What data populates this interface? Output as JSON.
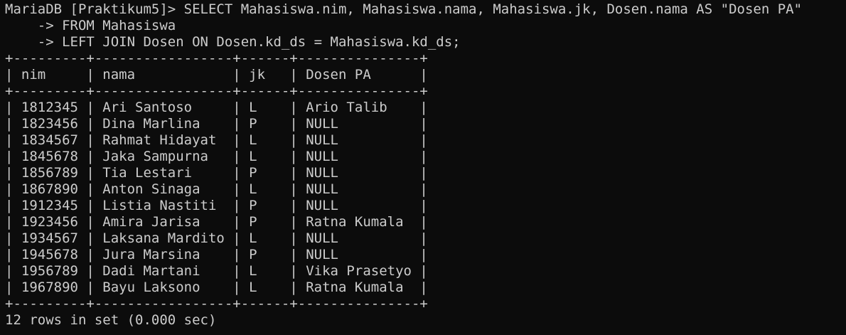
{
  "terminal": {
    "prompt": "MariaDB [Praktikum5]>",
    "query_line_1": "MariaDB [Praktikum5]> SELECT Mahasiswa.nim, Mahasiswa.nama, Mahasiswa.jk, Dosen.nama AS \"Dosen PA\"",
    "query_line_2": "    -> FROM Mahasiswa",
    "query_line_3": "    -> LEFT JOIN Dosen ON Dosen.kd_ds = Mahasiswa.kd_ds;",
    "border_top": "+---------+-----------------+------+---------------+",
    "header_row": "| nim     | nama            | jk   | Dosen PA      |",
    "border_mid": "+---------+-----------------+------+---------------+",
    "rows": [
      "| 1812345 | Ari Santoso     | L    | Ario Talib    |",
      "| 1823456 | Dina Marlina    | P    | NULL          |",
      "| 1834567 | Rahmat Hidayat  | L    | NULL          |",
      "| 1845678 | Jaka Sampurna   | L    | NULL          |",
      "| 1856789 | Tia Lestari     | P    | NULL          |",
      "| 1867890 | Anton Sinaga    | L    | NULL          |",
      "| 1912345 | Listia Nastiti  | P    | NULL          |",
      "| 1923456 | Amira Jarisa    | P    | Ratna Kumala  |",
      "| 1934567 | Laksana Mardito | L    | NULL          |",
      "| 1945678 | Jura Marsina    | P    | NULL          |",
      "| 1956789 | Dadi Martani    | L    | Vika Prasetyo |",
      "| 1967890 | Bayu Laksono    | L    | Ratna Kumala  |"
    ],
    "border_bottom": "+---------+-----------------+------+---------------+",
    "status": "12 rows in set (0.000 sec)"
  },
  "colors": {
    "background": "#0c0c0c",
    "foreground": "#cccccc"
  }
}
